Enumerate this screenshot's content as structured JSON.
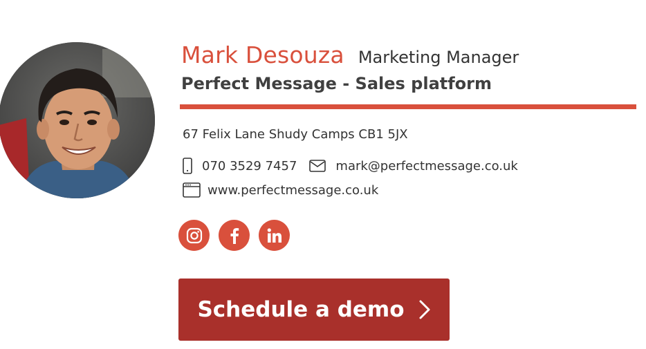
{
  "person": {
    "name": "Mark Desouza",
    "job_title": "Marketing Manager",
    "company": "Perfect Message - Sales platform"
  },
  "contact": {
    "address": "67 Felix Lane Shudy Camps CB1 5JX",
    "phone": "070 3529 7457",
    "email": "mark@perfectmessage.co.uk",
    "website": "www.perfectmessage.co.uk"
  },
  "icons": {
    "phone": "mobile-phone-icon",
    "email": "envelope-icon",
    "website": "browser-window-icon"
  },
  "social": [
    {
      "network": "instagram",
      "icon": "instagram-icon"
    },
    {
      "network": "facebook",
      "icon": "facebook-icon"
    },
    {
      "network": "linkedin",
      "icon": "linkedin-icon"
    }
  ],
  "cta": {
    "label": "Schedule a demo",
    "icon": "chevron-right-icon"
  },
  "colors": {
    "accent": "#d9503c",
    "button": "#a9302b",
    "text": "#333333"
  }
}
